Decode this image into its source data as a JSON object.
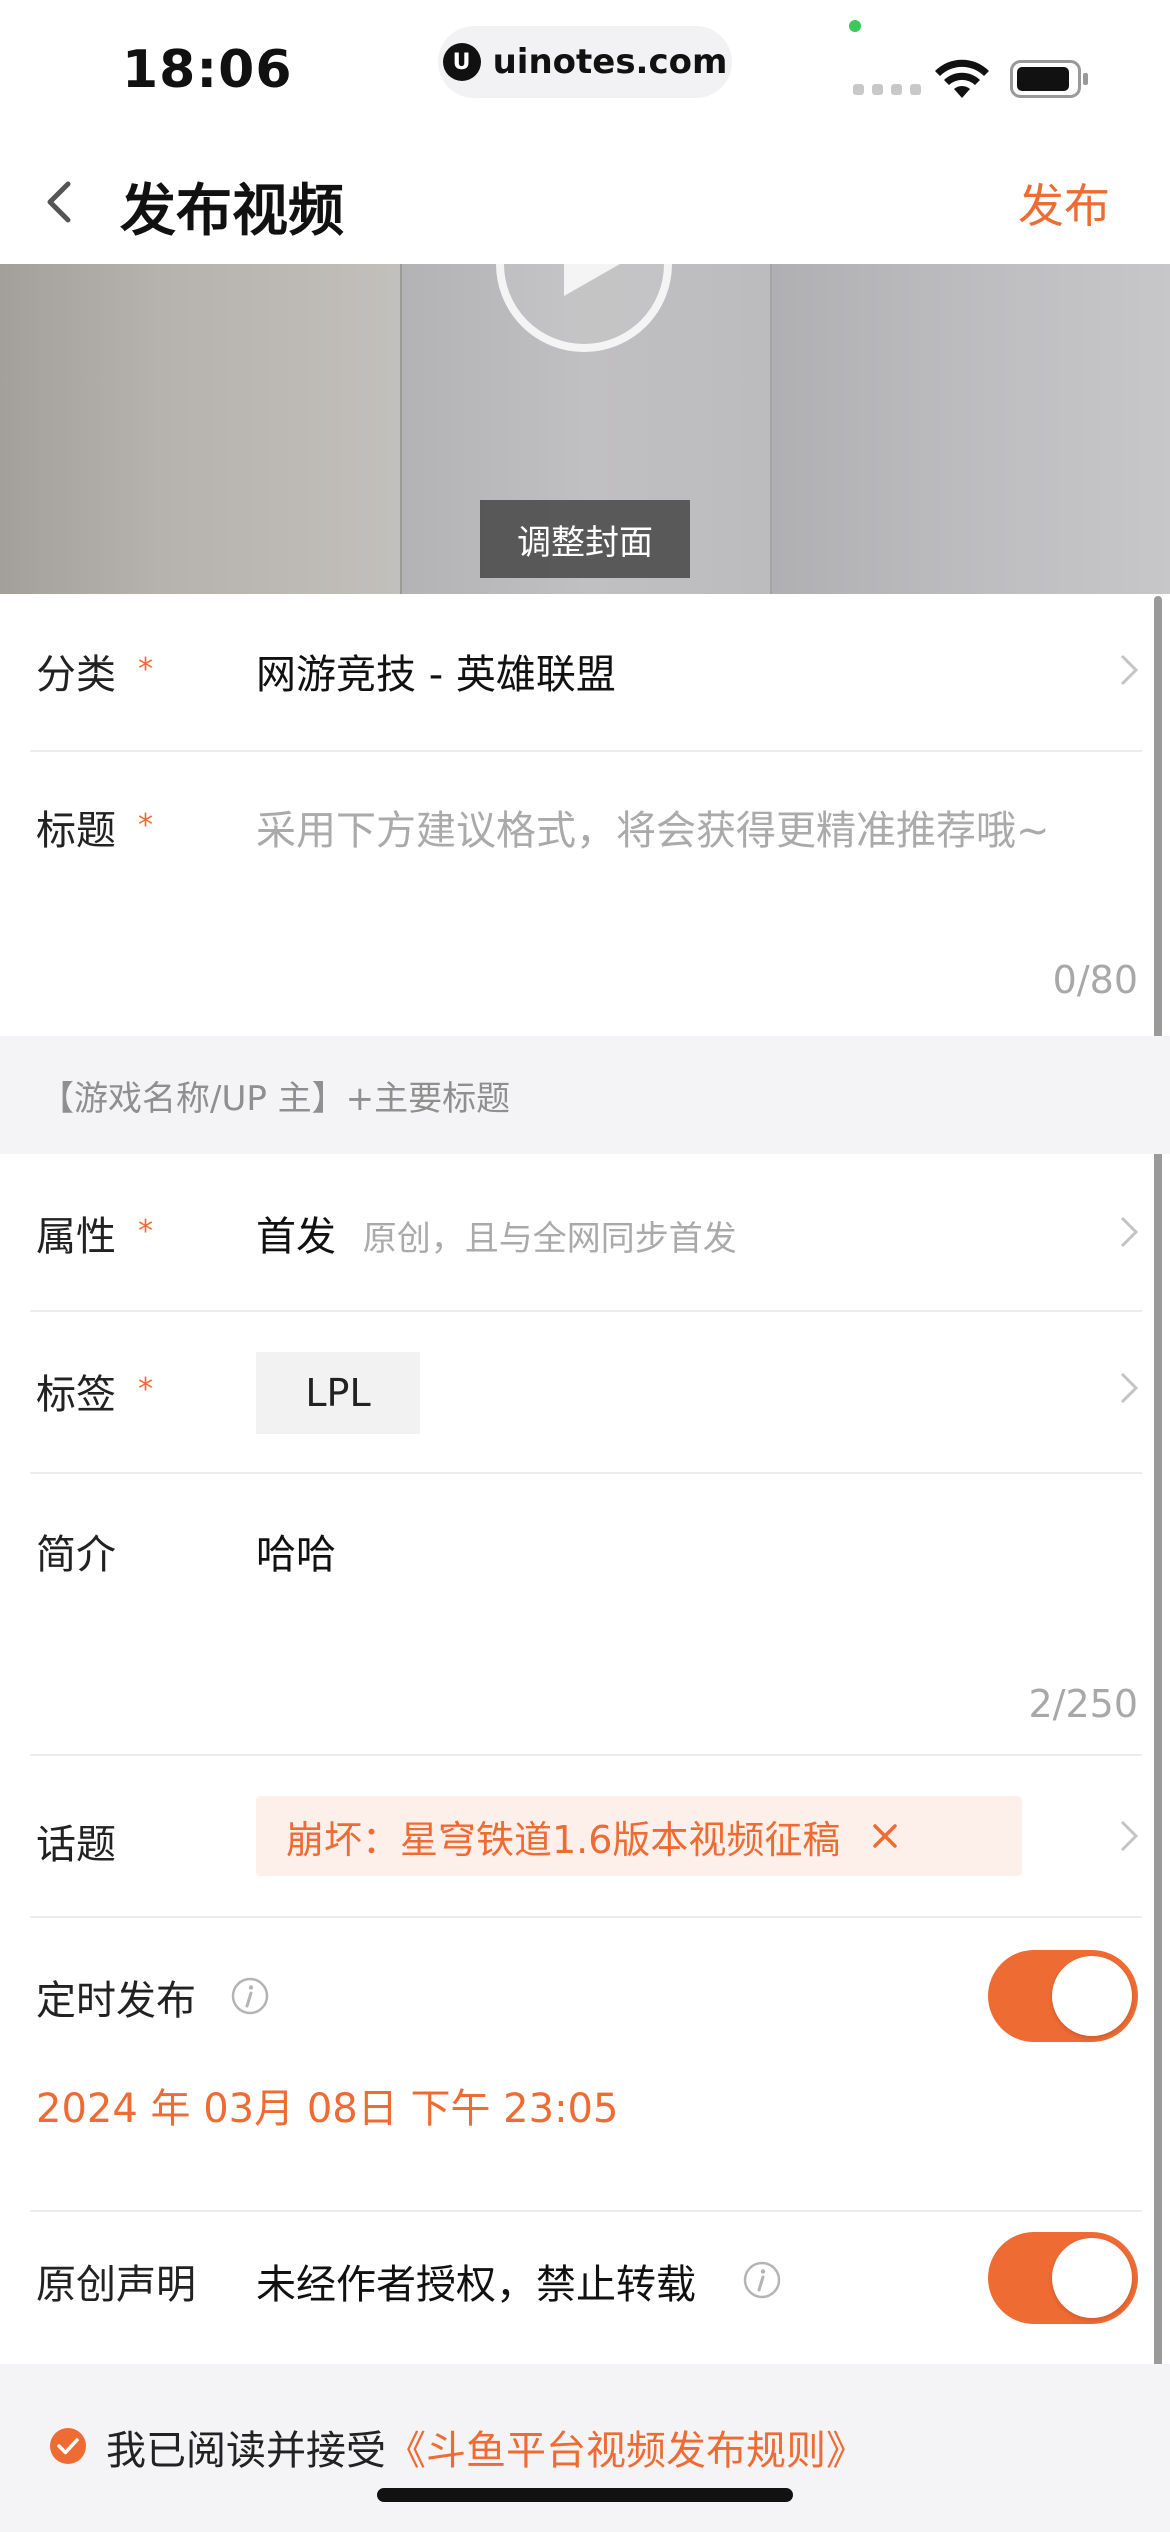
{
  "status_bar": {
    "time": "18:06",
    "url": "uinotes.com",
    "url_logo": "U"
  },
  "nav": {
    "title": "发布视频",
    "publish": "发布"
  },
  "cover": {
    "adjust_label": "调整封面"
  },
  "form": {
    "category": {
      "label": "分类",
      "required": "*",
      "value": "网游竞技 - 英雄联盟"
    },
    "title": {
      "label": "标题",
      "required": "*",
      "placeholder": "采用下方建议格式，将会获得更精准推荐哦~",
      "counter": "0/80"
    },
    "title_suggestion": "【游戏名称/UP 主】+主要标题",
    "attribute": {
      "label": "属性",
      "required": "*",
      "value": "首发",
      "hint": "原创，且与全网同步首发"
    },
    "tags": {
      "label": "标签",
      "required": "*",
      "chip": "LPL"
    },
    "intro": {
      "label": "简介",
      "value": "哈哈",
      "counter": "2/250"
    },
    "topic": {
      "label": "话题",
      "chip": "崩坏：星穹铁道1.6版本视频征稿"
    },
    "schedule": {
      "label": "定时发布",
      "enabled": true,
      "date": "2024 年 03月 08日 下午 23:05"
    },
    "original": {
      "label": "原创声明",
      "text": "未经作者授权，禁止转载",
      "enabled": true
    }
  },
  "footer": {
    "agree_text": "我已阅读并接受",
    "agree_link": "《斗鱼平台视频发布规则》"
  },
  "colors": {
    "accent": "#ee6b33",
    "hint": "#aaaaaa",
    "band": "#f4f4f6"
  }
}
